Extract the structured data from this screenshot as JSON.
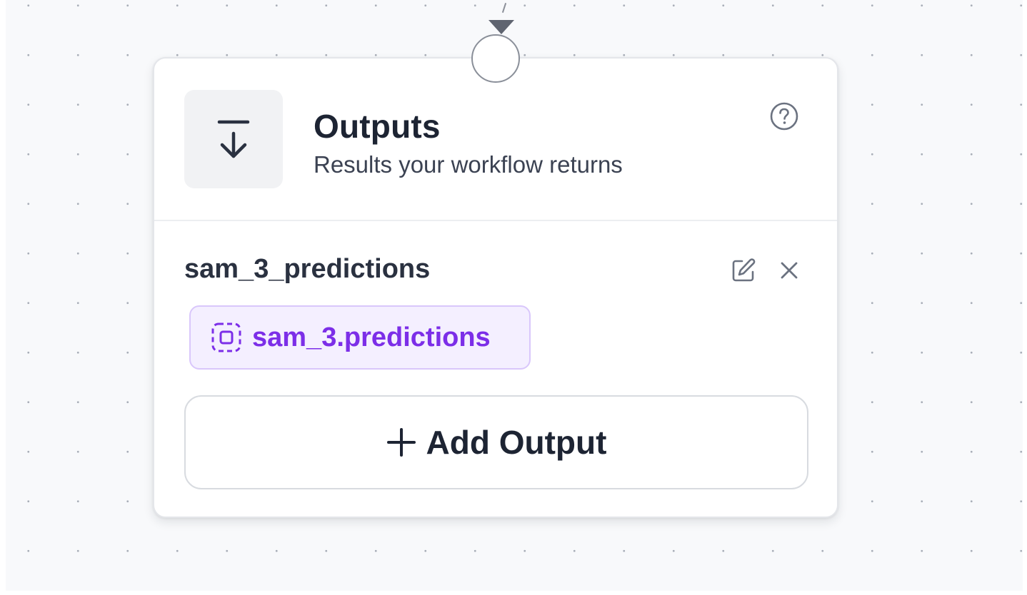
{
  "node": {
    "title": "Outputs",
    "subtitle": "Results your workflow returns",
    "icon": "download-arrow-icon",
    "help_icon": "help-circle-icon"
  },
  "output_item": {
    "name": "sam_3_predictions",
    "selector": "sam_3.predictions",
    "selector_icon": "dashed-selector-icon",
    "edit_icon": "edit-icon",
    "remove_icon": "close-icon"
  },
  "add_button": {
    "label": "Add Output",
    "icon": "plus-icon"
  },
  "colors": {
    "canvas_bg": "#f8f9fb",
    "chip_bg": "#f4efff",
    "chip_text": "#7c2ee8",
    "title_text": "#1d2433"
  }
}
